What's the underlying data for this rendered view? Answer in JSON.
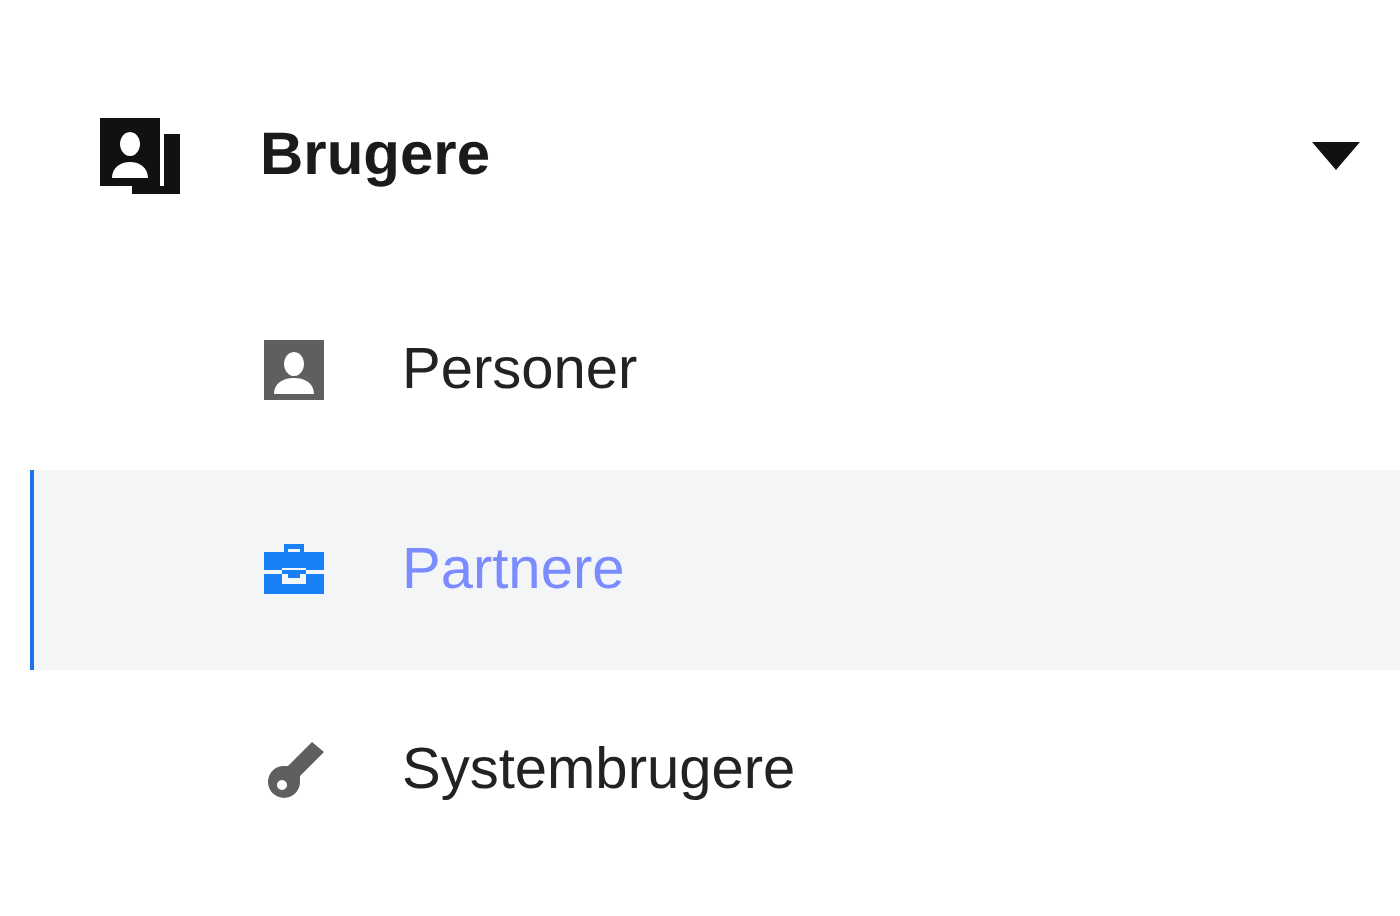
{
  "group": {
    "label": "Brugere",
    "expanded": true,
    "items": [
      {
        "label": "Personer",
        "selected": false
      },
      {
        "label": "Partnere",
        "selected": true
      },
      {
        "label": "Systembrugere",
        "selected": false
      }
    ]
  }
}
